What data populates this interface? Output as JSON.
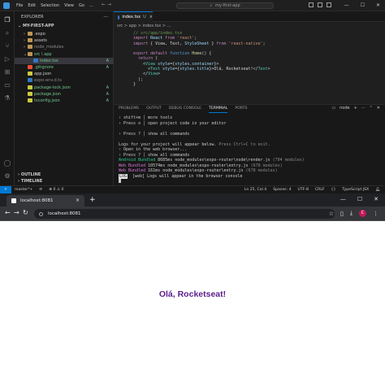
{
  "vscode": {
    "menu": [
      "File",
      "Edit",
      "Selection",
      "View",
      "Go",
      "..."
    ],
    "search_text": "my-first-app",
    "sidebar": {
      "title": "EXPLORER",
      "more": "...",
      "project": "MY-FIRST-APP",
      "tree": [
        {
          "label": ".expo",
          "depth": 1,
          "badge": "",
          "color": "#cccccc",
          "icon": "folder-icon",
          "chev": "›"
        },
        {
          "label": "assets",
          "depth": 1,
          "badge": "",
          "color": "#cccccc",
          "icon": "folder-icon",
          "chev": "›"
        },
        {
          "label": "node_modules",
          "depth": 1,
          "badge": "",
          "color": "#8b8b8b",
          "icon": "folder-icon",
          "chev": "›"
        },
        {
          "label": "src \\ app",
          "depth": 1,
          "badge": "",
          "color": "#73c991",
          "icon": "folder-icon",
          "chev": "⌄"
        },
        {
          "label": "index.tsx",
          "depth": 2,
          "badge": "A",
          "color": "#73c991",
          "icon": "tsx-file-icon",
          "chev": ""
        },
        {
          "label": ".gitignore",
          "depth": 1,
          "badge": "A",
          "color": "#73c991",
          "icon": "git-file-icon",
          "chev": ""
        },
        {
          "label": "app.json",
          "depth": 1,
          "badge": "",
          "color": "#cccccc",
          "icon": "json-file-icon",
          "chev": ""
        },
        {
          "label": "expo-env.d.ts",
          "depth": 1,
          "badge": "",
          "color": "#8b8b8b",
          "icon": "ts-file-icon",
          "chev": ""
        },
        {
          "label": "package-lock.json",
          "depth": 1,
          "badge": "A",
          "color": "#73c991",
          "icon": "json-file-icon",
          "chev": ""
        },
        {
          "label": "package.json",
          "depth": 1,
          "badge": "A",
          "color": "#73c991",
          "icon": "json-file-icon",
          "chev": ""
        },
        {
          "label": "tsconfig.json",
          "depth": 1,
          "badge": "A",
          "color": "#73c991",
          "icon": "json-file-icon",
          "chev": ""
        }
      ],
      "outline": "OUTLINE",
      "timeline": "TIMELINE"
    },
    "tab": {
      "label": "index.tsx",
      "modified": "U",
      "close": "×"
    },
    "breadcrumbs": "src > app > index.tsx > ...",
    "code_lines": [
      "// src/app/index.tsx",
      "import React from 'react';",
      "import { View, Text, StyleSheet } from 'react-native';",
      "",
      "export default function Home() {",
      "  return (",
      "    <View style={styles.container}>",
      "      <Text style={styles.title}>Olá, Rocketseat!</Text>",
      "    </View>",
      "  );",
      "}"
    ],
    "panel_tabs": [
      "PROBLEMS",
      "OUTPUT",
      "DEBUG CONSOLE",
      "TERMINAL",
      "PORTS"
    ],
    "panel_active": "TERMINAL",
    "terminal_name": "node",
    "terminal_lines": [
      "› shift+m │ more tools",
      "› Press o │ open project code in your editor",
      "",
      "› Press ? │ show all commands",
      "",
      "Logs for your project will appear below. Press Ctrl+C to exit.",
      "› Open in the web browser...",
      "› Press ? │ show all commands",
      "Android Bundled 8685ms node_modules\\expo-router\\node\\render.js (704 modules)",
      "Web Bundled 10574ms node_modules\\expo-router\\entry.js (678 modules)",
      "Web Bundled 161ms node_modules\\expo-router\\entry.js (678 modules)",
      "LOG  [web] Logs will appear in the browser console"
    ],
    "status": {
      "remote": "⚡",
      "branch": "master*+",
      "sync": "⟳",
      "problems": "⊗ 0  ⚠ 0",
      "position": "Ln 25, Col 4",
      "spaces": "Spaces: 4",
      "encoding": "UTF-8",
      "eol": "CRLF",
      "braces": "{}",
      "language": "TypeScript JSX"
    }
  },
  "browser": {
    "tab_title": "localhost:8081",
    "tab_close": "×",
    "new_tab": "+",
    "url": "localhost:8081",
    "avatar": "C",
    "content_text": "Olá, Rocketseat!"
  },
  "colors": {
    "accent": "#0078d4",
    "page_text": "#5b1d8c",
    "git_added": "#73c991"
  }
}
